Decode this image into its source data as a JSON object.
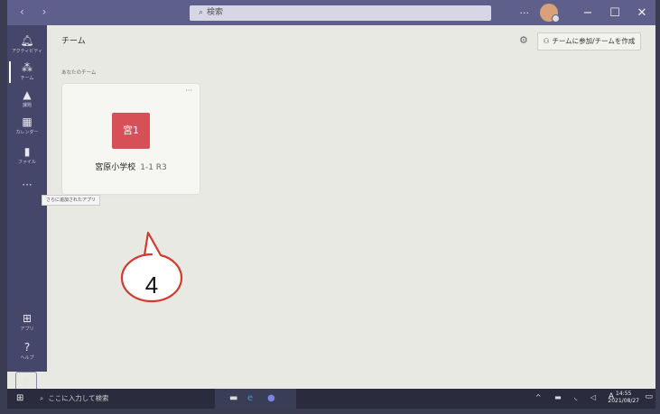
{
  "titlebar": {
    "search_placeholder": "検索",
    "more": "···",
    "controls": {
      "minimize": "−",
      "maximize": "☐",
      "close": "✕"
    }
  },
  "rail": {
    "items": [
      {
        "label": "アクティビティ",
        "icon": "bell-icon"
      },
      {
        "label": "チーム",
        "icon": "teams-icon"
      },
      {
        "label": "課題",
        "icon": "assignments-icon"
      },
      {
        "label": "カレンダー",
        "icon": "calendar-icon"
      },
      {
        "label": "ファイル",
        "icon": "file-icon"
      }
    ],
    "more_label": "···",
    "apps_label": "アプリ",
    "help_label": "ヘルプ"
  },
  "main": {
    "title": "チーム",
    "join_button": "チームに参加/チームを作成",
    "section_title": "あなたのチーム",
    "team": {
      "tile_text": "宮1",
      "name": "宮原小学校",
      "class_label": "1-1 R3",
      "tile_color": "#d74f57"
    },
    "tooltip": "さらに追加されたアプリ"
  },
  "callout": {
    "number": "4"
  },
  "taskbar": {
    "search_placeholder": "ここに入力して検索",
    "ime": "A",
    "time": "14:55",
    "date": "2021/08/27"
  },
  "colors": {
    "titlebar": "#5e5f8a",
    "rail": "#45476a",
    "accent": "#d74f57"
  }
}
